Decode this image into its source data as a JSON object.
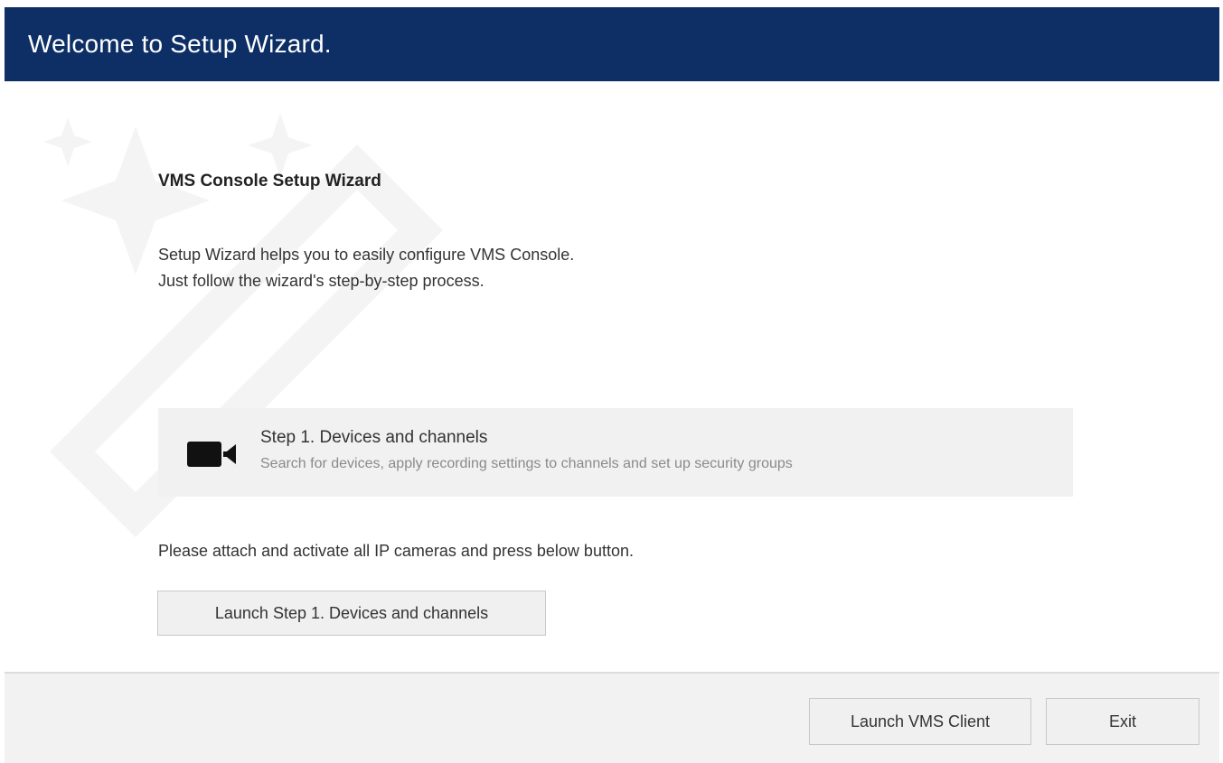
{
  "window": {
    "title": "Welcome to Setup Wizard."
  },
  "main": {
    "heading": "VMS Console Setup Wizard",
    "intro_line1": "Setup Wizard helps you to easily configure VMS Console.",
    "intro_line2": "Just follow the wizard's step-by-step process.",
    "step": {
      "icon": "video-camera-icon",
      "title": "Step 1. Devices and channels",
      "description": "Search for devices, apply recording settings to channels and set up security groups"
    },
    "instruction": "Please attach and activate all IP cameras and press below button.",
    "launch_step_label": "Launch Step 1. Devices and channels"
  },
  "footer": {
    "launch_client_label": "Launch VMS Client",
    "exit_label": "Exit"
  },
  "colors": {
    "titlebar": "#0d2f66",
    "step_card": "#f1f1f1",
    "footer": "#f2f2f2"
  }
}
